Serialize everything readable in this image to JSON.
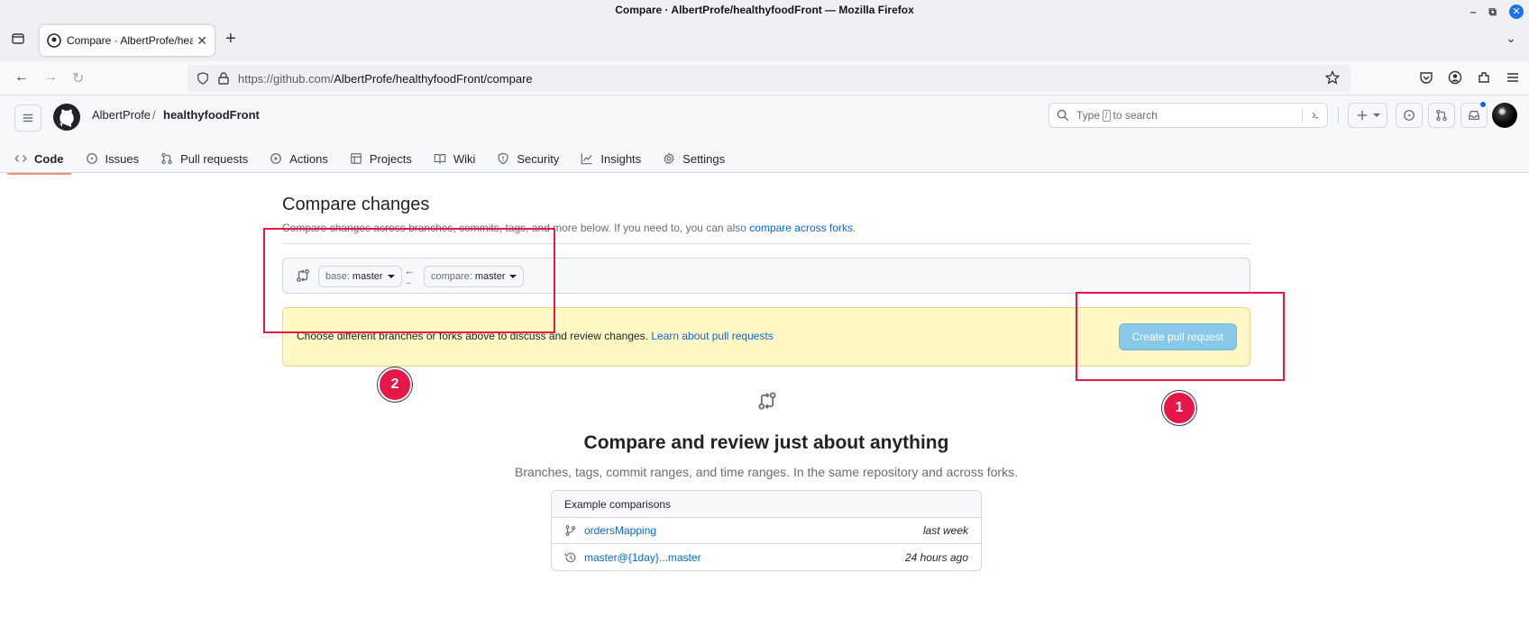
{
  "window": {
    "title": "Compare · AlbertProfe/healthyfoodFront — Mozilla Firefox",
    "min": "–",
    "max": "⧉",
    "close": "✕"
  },
  "browser": {
    "tab_title": "Compare · AlbertProfe/heal",
    "tab_close": "✕",
    "new_tab": "+",
    "tab_list": "⌄",
    "url_domain": "https://github.com/",
    "url_path": "AlbertProfe/healthyfoodFront/compare",
    "back": "←",
    "forward": "→",
    "reload": "↻"
  },
  "github": {
    "owner": "AlbertProfe",
    "slash": "/",
    "repo": "healthyfoodFront",
    "search_type": "Type",
    "search_key": "/",
    "search_rest": "to search",
    "nav": [
      {
        "label": "Code",
        "icon": "code-icon"
      },
      {
        "label": "Issues",
        "icon": "issue-icon"
      },
      {
        "label": "Pull requests",
        "icon": "pull-request-icon"
      },
      {
        "label": "Actions",
        "icon": "play-icon"
      },
      {
        "label": "Projects",
        "icon": "table-icon"
      },
      {
        "label": "Wiki",
        "icon": "book-icon"
      },
      {
        "label": "Security",
        "icon": "shield-icon"
      },
      {
        "label": "Insights",
        "icon": "graph-icon"
      },
      {
        "label": "Settings",
        "icon": "gear-icon"
      }
    ]
  },
  "compare": {
    "title": "Compare changes",
    "subtitle_text": "Compare changes across branches, commits, tags, and more below. If you need to, you can also ",
    "subtitle_link": "compare across forks",
    "subtitle_end": ".",
    "base_label": "base:",
    "base_value": "master",
    "compare_label": "compare:",
    "compare_value": "master",
    "arrow": "←",
    "dots": "...",
    "flash_text": "Choose different branches or forks above to discuss and review changes. ",
    "flash_link": "Learn about pull requests",
    "create_pr": "Create pull request",
    "big_title": "Compare and review just about anything",
    "big_sub": "Branches, tags, commit ranges, and time ranges. In the same repository and across forks.",
    "examples_header": "Example comparisons",
    "examples": [
      {
        "name": "ordersMapping",
        "when": "last week",
        "icon": "branch-icon"
      },
      {
        "name": "master@{1day}...master",
        "when": "24 hours ago",
        "icon": "history-icon"
      }
    ]
  },
  "annotations": {
    "badge_1": "1",
    "badge_2": "2",
    "color": "#e8174a"
  }
}
